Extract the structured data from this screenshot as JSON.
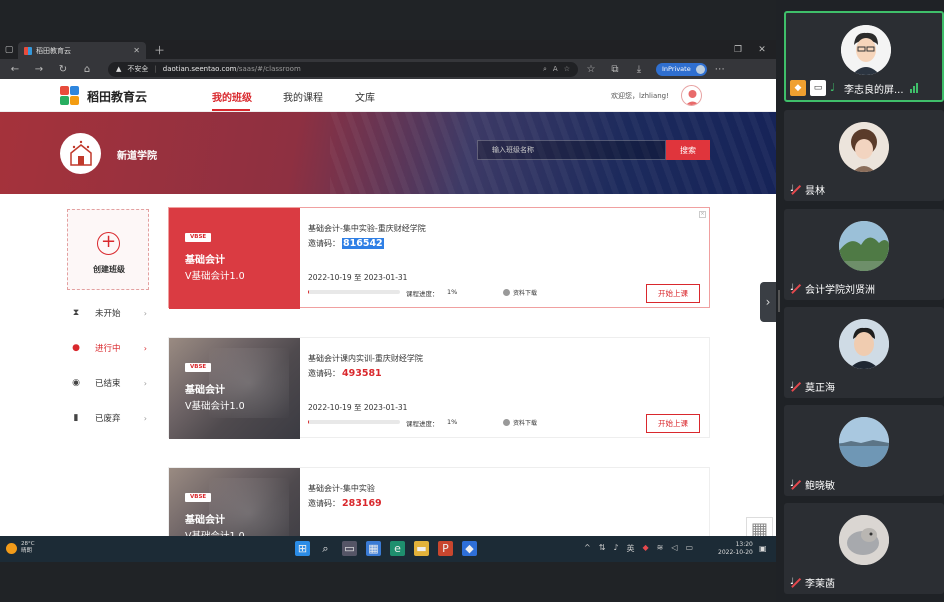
{
  "browser": {
    "tab_title": "稻田教育云",
    "security_label": "不安全",
    "url_host": "daotian.seentao.com",
    "url_path": "/saas/#/classroom",
    "private_label": "InPrivate"
  },
  "site": {
    "logo_text": "稻田教育云",
    "nav": [
      "我的班级",
      "我的课程",
      "文库"
    ],
    "welcome": "欢迎您，lzhliang!"
  },
  "banner": {
    "school_name": "新道学院",
    "search_placeholder": "输入班级名称",
    "search_button": "搜索"
  },
  "sidebar": {
    "create_label": "创建班级",
    "items": [
      {
        "label": "未开始",
        "icon": "hourglass-icon"
      },
      {
        "label": "进行中",
        "icon": "bulb-icon"
      },
      {
        "label": "已结束",
        "icon": "stop-icon"
      },
      {
        "label": "已废弃",
        "icon": "trash-icon"
      }
    ]
  },
  "cards": [
    {
      "badge": "VBSE",
      "title": "基础会计",
      "subtitle": "V基础会计1.0",
      "course": "基础会计-集中实验-重庆财经学院",
      "invite_label": "邀请码：",
      "invite_code": "816542",
      "dates": "2022-10-19 至 2023-01-31",
      "progress_label": "课程进度：",
      "progress_value": "1%",
      "progress": 1,
      "material": "资料下载",
      "button": "开始上课"
    },
    {
      "badge": "VBSE",
      "title": "基础会计",
      "subtitle": "V基础会计1.0",
      "course": "基础会计课内实训-重庆财经学院",
      "invite_label": "邀请码：",
      "invite_code": "493581",
      "dates": "2022-10-19 至 2023-01-31",
      "progress_label": "课程进度：",
      "progress_value": "1%",
      "progress": 1,
      "material": "资料下载",
      "button": "开始上课"
    },
    {
      "badge": "VBSE",
      "title": "基础会计",
      "subtitle": "V基础会计1.0",
      "course": "基础会计-集中实验",
      "invite_label": "邀请码：",
      "invite_code": "283169"
    }
  ],
  "taskbar": {
    "weather_temp": "28°C",
    "weather_desc": "晴朗",
    "time": "13:20",
    "date": "2022-10-20"
  },
  "participants": [
    {
      "name": "李志良的屏...",
      "speaking": true
    },
    {
      "name": "昙林"
    },
    {
      "name": "会计学院刘贤洲"
    },
    {
      "name": "莫正海"
    },
    {
      "name": "鲍晓敏"
    },
    {
      "name": "李茉菡"
    }
  ],
  "colors": {
    "brand_red": "#d9282d",
    "speaking_green": "#3fbf6a"
  }
}
